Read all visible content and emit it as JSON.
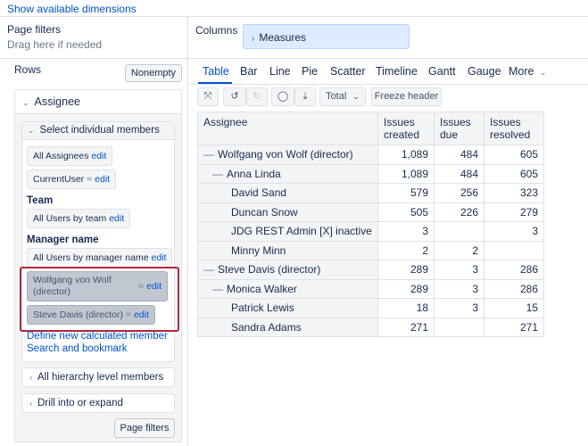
{
  "top": {
    "show_dimensions": "Show available dimensions"
  },
  "page_filters": {
    "title": "Page filters",
    "hint": "Drag here if needed"
  },
  "columns": {
    "label": "Columns",
    "measures": "Measures"
  },
  "rows": {
    "label": "Rows",
    "nonempty": "Nonempty",
    "assignee": {
      "title": "Assignee",
      "select_members": "Select individual members",
      "chips": {
        "all_assignees": "All Assignees",
        "current_user": "CurrentUser",
        "all_users_team": "All Users by team",
        "all_users_manager": "All Users by manager name",
        "wolfgang_line1": "Wolfgang von Wolf",
        "wolfgang_line2": "(director)",
        "steve": "Steve Davis (director)"
      },
      "edit": "edit",
      "eq": "=",
      "team_label": "Team",
      "manager_label": "Manager name",
      "define_calc": "Define new calculated member",
      "search_bookmark": "Search and bookmark",
      "all_hierarchy": "All hierarchy level members",
      "drill": "Drill into or expand",
      "page_filters_btn": "Page filters"
    }
  },
  "tabs": [
    "Table",
    "Bar",
    "Line",
    "Pie",
    "Scatter",
    "Timeline",
    "Gantt",
    "Gauge",
    "More"
  ],
  "toolbar": {
    "total": "Total",
    "freeze": "Freeze header"
  },
  "table": {
    "row_header": "Assignee",
    "col_headers": [
      [
        "Issues",
        "created"
      ],
      [
        "Issues",
        "due"
      ],
      [
        "Issues",
        "resolved"
      ]
    ],
    "rows": [
      {
        "level": 0,
        "prefix": "—",
        "name": "Wolfgang von Wolf (director)",
        "created": "1,089",
        "due": "484",
        "resolved": "605"
      },
      {
        "level": 1,
        "prefix": "—",
        "name": "Anna Linda",
        "created": "1,089",
        "due": "484",
        "resolved": "605"
      },
      {
        "level": 2,
        "prefix": "",
        "name": "David Sand",
        "created": "579",
        "due": "256",
        "resolved": "323"
      },
      {
        "level": 2,
        "prefix": "",
        "name": "Duncan Snow",
        "created": "505",
        "due": "226",
        "resolved": "279"
      },
      {
        "level": 2,
        "prefix": "",
        "name": "JDG REST Admin [X] inactive",
        "created": "3",
        "due": "",
        "resolved": "3"
      },
      {
        "level": 2,
        "prefix": "",
        "name": "Minny Minn",
        "created": "2",
        "due": "2",
        "resolved": ""
      },
      {
        "level": 0,
        "prefix": "—",
        "name": "Steve Davis (director)",
        "created": "289",
        "due": "3",
        "resolved": "286"
      },
      {
        "level": 1,
        "prefix": "—",
        "name": "Monica Walker",
        "created": "289",
        "due": "3",
        "resolved": "286"
      },
      {
        "level": 2,
        "prefix": "",
        "name": "Patrick Lewis",
        "created": "18",
        "due": "3",
        "resolved": "15"
      },
      {
        "level": 2,
        "prefix": "",
        "name": "Sandra Adams",
        "created": "271",
        "due": "",
        "resolved": "271"
      }
    ]
  },
  "colors": {
    "accent": "#0052cc",
    "highlight": "#b3263c",
    "chip_selected": "#c1c7d0"
  }
}
